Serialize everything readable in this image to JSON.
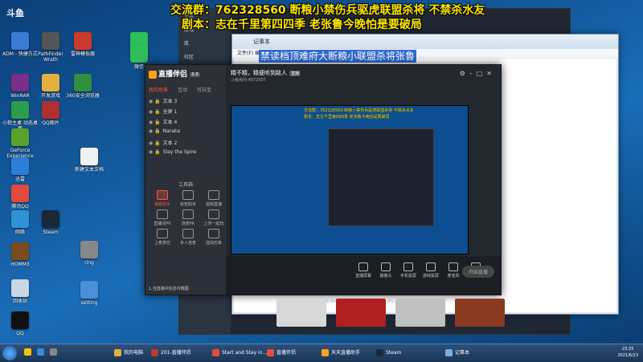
{
  "overlay": {
    "line1": "交流群：762328560 断粮小禁伤兵驱虎联盟杀将 不禁杀水友",
    "line2": "剧本：志在千里第四四季 老张鲁今晚怕是要破局"
  },
  "watermark": {
    "text": "斗鱼"
  },
  "desktop_icons": [
    {
      "label": "ADM - 快捷方式",
      "color": "#3a7bd5"
    },
    {
      "label": "WinRAR",
      "color": "#7a2f86"
    },
    {
      "label": "小狼主桌 动态桌面",
      "color": "#2a9d4a"
    },
    {
      "label": "GeForce Experience",
      "color": "#5ba12a"
    },
    {
      "label": "迅雷",
      "color": "#2b7fd8"
    },
    {
      "label": "腾讯QQ",
      "color": "#e14a3c"
    },
    {
      "label": "网络",
      "color": "#2e93d6"
    },
    {
      "label": "HOMM3",
      "color": "#7c4a1c"
    },
    {
      "label": "回收站",
      "color": "#c9d6e3"
    },
    {
      "label": "QQ",
      "color": "#111111"
    },
    {
      "label": "PathFinder Wrath",
      "color": "#555555"
    },
    {
      "label": "开发游戏",
      "color": "#e3b23c"
    },
    {
      "label": "QQ图片",
      "color": "#b03030"
    },
    {
      "label": "Steam",
      "color": "#1b2838"
    },
    {
      "label": "WeChat",
      "color": "#2fbf5a"
    },
    {
      "label": "微信",
      "color": "#2fbf5a"
    },
    {
      "label": "雷神模拟器",
      "color": "#cc3a2b"
    },
    {
      "label": "360安全浏览器",
      "color": "#2f8f3c"
    },
    {
      "label": "新建文本文档",
      "color": "#f1f1f1"
    },
    {
      "label": "ring",
      "color": "#888888"
    },
    {
      "label": "setting",
      "color": "#4a8fd8"
    }
  ],
  "bg_window": {
    "sidebar": [
      "主页",
      "游戏",
      "库",
      "社区"
    ]
  },
  "notepad": {
    "title": "记事本",
    "menu": "文件(F) 编辑(E) 格式(O) 查看(V) 帮助(H)",
    "selected_text": "禁读档顶难府大断粮小联盟杀将张鲁"
  },
  "app": {
    "name": "直播伴侣",
    "version": "3.5",
    "tabs": [
      "我的场景",
      "互动",
      "可玩宝"
    ],
    "active_tab": 0,
    "scenes": [
      "文本 3",
      "全屏 1",
      "文本 4",
      "Naraka",
      "文本 2",
      "Slay the Spire"
    ],
    "tools_title": "工具箱",
    "tools": [
      {
        "label": "弹幕助手",
        "hot": true
      },
      {
        "label": "房管助手",
        "hot": false
      },
      {
        "label": "视频直播",
        "hot": false
      },
      {
        "label": "直播间PK",
        "hot": false
      },
      {
        "label": "连麦PK",
        "hot": false
      },
      {
        "label": "上传一起玩",
        "hot": false
      },
      {
        "label": "上麦排位",
        "hot": false
      },
      {
        "label": "多人连麦",
        "hot": false
      },
      {
        "label": "虚拟形象",
        "hot": false
      }
    ],
    "banner": "1.当直播中信息可截图",
    "header_title": "精不精，精便听到敌人",
    "header_tag": "直播",
    "header_id": "斗鱼房间 4872507",
    "bottom_buttons": [
      "直播屏幕",
      "摄像头",
      "手机投屏",
      "游戏投屏",
      "麦克风",
      "扬声器"
    ],
    "start_button": "开始直播",
    "status_text": "本地录制 00:00:00  直播 00:00:00  CPU 4%  内存 52%",
    "preview_ov1": "交流群：762328560 断粮小禁伤兵驱虎联盟杀将 不禁杀水友",
    "preview_ov2": "剧本：志在千里第四四季 老张鲁今晚怕是要破局"
  },
  "taskbar": {
    "items": [
      {
        "label": "我的电脑",
        "color": "#e0b040"
      },
      {
        "label": "201-直播伴侣",
        "color": "#c0392b"
      },
      {
        "label": "Start and Stay in...",
        "color": "#e84c3d"
      },
      {
        "label": "直播伴侣",
        "color": "#e84c3d"
      },
      {
        "label": "天天直播助手",
        "color": "#ffa21a"
      },
      {
        "label": "Steam",
        "color": "#1b2838"
      },
      {
        "label": "记事本",
        "color": "#7ab0e0"
      }
    ],
    "time": "23:25",
    "date": "2021/6/23"
  },
  "thumbnails": [
    {
      "name": "panda",
      "color": "#d8d8d8"
    },
    {
      "name": "Shadow Tactics",
      "color": "#b02020"
    },
    {
      "name": "silhouette",
      "color": "#c0c0c0"
    },
    {
      "name": "War Hunger Direct",
      "color": "#8a3a20"
    }
  ]
}
